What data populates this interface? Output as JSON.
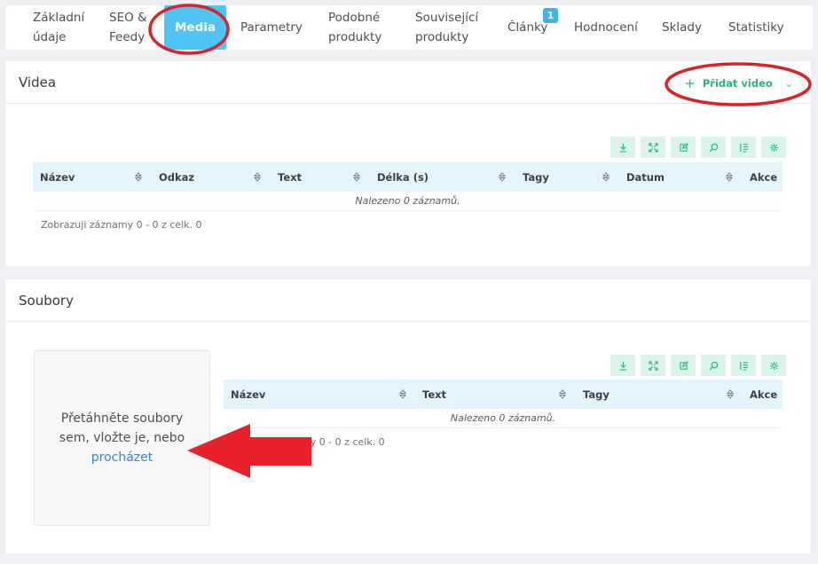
{
  "tabs": [
    {
      "l1": "Základní",
      "l2": "údaje"
    },
    {
      "l1": "SEO &",
      "l2": "Feedy"
    },
    {
      "l1": "Media"
    },
    {
      "l1": "Parametry"
    },
    {
      "l1": "Podobné",
      "l2": "produkty"
    },
    {
      "l1": "Související",
      "l2": "produkty"
    },
    {
      "l1": "Články",
      "badge": "1"
    },
    {
      "l1": "Hodnocení"
    },
    {
      "l1": "Sklady"
    },
    {
      "l1": "Statistiky"
    }
  ],
  "videos": {
    "title": "Videa",
    "add_label": "Přidat video",
    "columns": [
      "Název",
      "Odkaz",
      "Text",
      "Délka (s)",
      "Tagy",
      "Datum",
      "Akce"
    ],
    "empty": "Nalezeno 0 záznamů.",
    "info": "Zobrazuji záznamy 0 - 0 z celk. 0"
  },
  "files": {
    "title": "Soubory",
    "drop_l1": "Přetáhněte soubory",
    "drop_l2": "sem, vložte je, nebo",
    "drop_browse": "procházet",
    "columns": [
      "Název",
      "Text",
      "Tagy",
      "Akce"
    ],
    "empty": "Nalezeno 0 záznamů.",
    "info": "my 0 - 0 z celk. 0"
  },
  "toolbar_icons": [
    "download-icon",
    "expand-icon",
    "edit-icon",
    "search-icon",
    "list-icon",
    "settings-icon"
  ],
  "colors": {
    "active_tab": "#50c4f2",
    "accent_green": "#2fb47d",
    "table_header": "#e3f4fc",
    "annotation_red": "#d8232a"
  }
}
